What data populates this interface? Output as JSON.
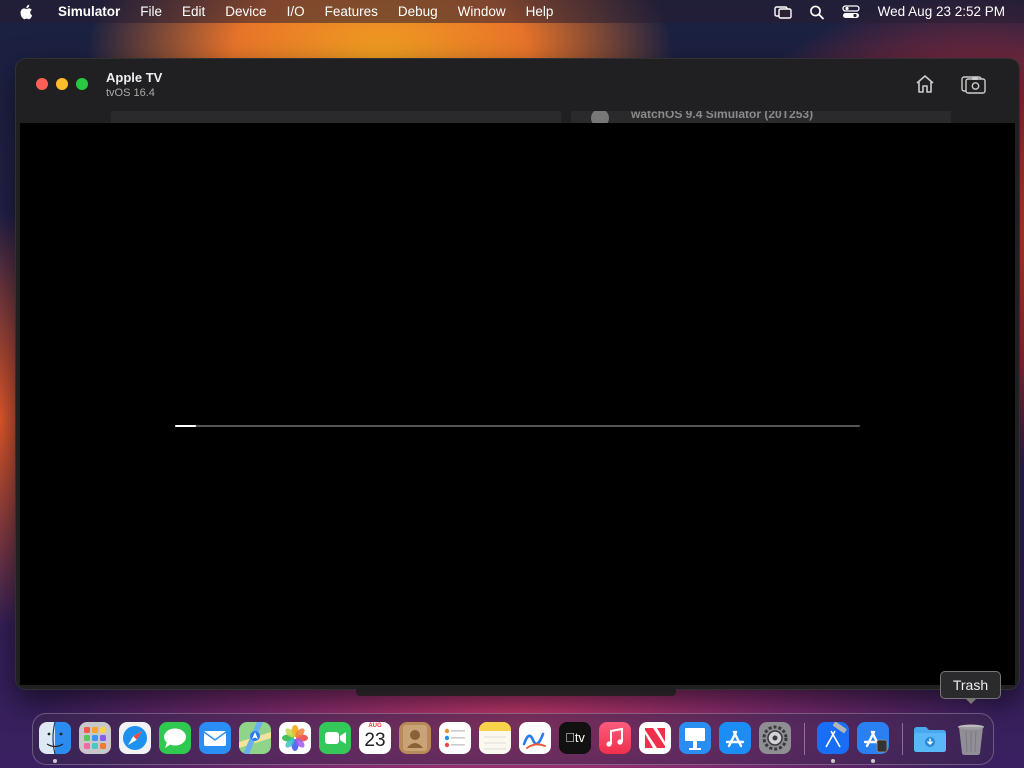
{
  "menubar": {
    "app_name": "Simulator",
    "menus": [
      "File",
      "Edit",
      "Device",
      "I/O",
      "Features",
      "Debug",
      "Window",
      "Help"
    ],
    "clock": "Wed Aug 23  2:52 PM"
  },
  "window": {
    "title": "Apple TV",
    "subtitle": "tvOS 16.4",
    "behind_text": "watchOS 9.4 Simulator (20T253)"
  },
  "screen": {
    "progress": 0.03
  },
  "tooltip": {
    "text": "Trash"
  },
  "dock": {
    "calendar_month": "AUG",
    "calendar_day": "23",
    "tv_label": "tv",
    "apps": [
      "finder-icon",
      "launchpad-icon",
      "safari-icon",
      "messages-icon",
      "mail-icon",
      "maps-icon",
      "photos-icon",
      "facetime-icon",
      "calendar-icon",
      "contacts-icon",
      "reminders-icon",
      "notes-icon",
      "freeform-icon",
      "apple-tv-icon",
      "music-icon",
      "news-icon",
      "keynote-icon",
      "app-store-icon",
      "system-settings-icon",
      "xcode-icon",
      "simulator-icon",
      "downloads-folder-icon",
      "trash-icon"
    ]
  }
}
